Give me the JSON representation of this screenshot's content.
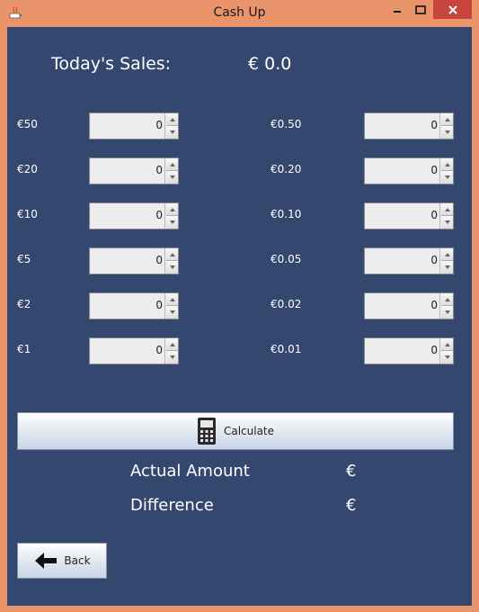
{
  "window": {
    "title": "Cash Up"
  },
  "sales": {
    "label": "Today's Sales:",
    "value": "€ 0.0"
  },
  "denominations_left": [
    {
      "label": "€50",
      "value": "0"
    },
    {
      "label": "€20",
      "value": "0"
    },
    {
      "label": "€10",
      "value": "0"
    },
    {
      "label": "€5",
      "value": "0"
    },
    {
      "label": "€2",
      "value": "0"
    },
    {
      "label": "€1",
      "value": "0"
    }
  ],
  "denominations_right": [
    {
      "label": "€0.50",
      "value": "0"
    },
    {
      "label": "€0.20",
      "value": "0"
    },
    {
      "label": "€0.10",
      "value": "0"
    },
    {
      "label": "€0.05",
      "value": "0"
    },
    {
      "label": "€0.02",
      "value": "0"
    },
    {
      "label": "€0.01",
      "value": "0"
    }
  ],
  "calculate": {
    "label": "Calculate",
    "icon": "calculator-icon"
  },
  "actual_amount": {
    "label": "Actual Amount",
    "value": "€"
  },
  "difference": {
    "label": "Difference",
    "value": "€"
  },
  "back": {
    "label": "Back",
    "icon": "arrow-left-icon"
  },
  "colors": {
    "background": "#34486f",
    "frame": "#e9946a",
    "close": "#c7453c"
  }
}
